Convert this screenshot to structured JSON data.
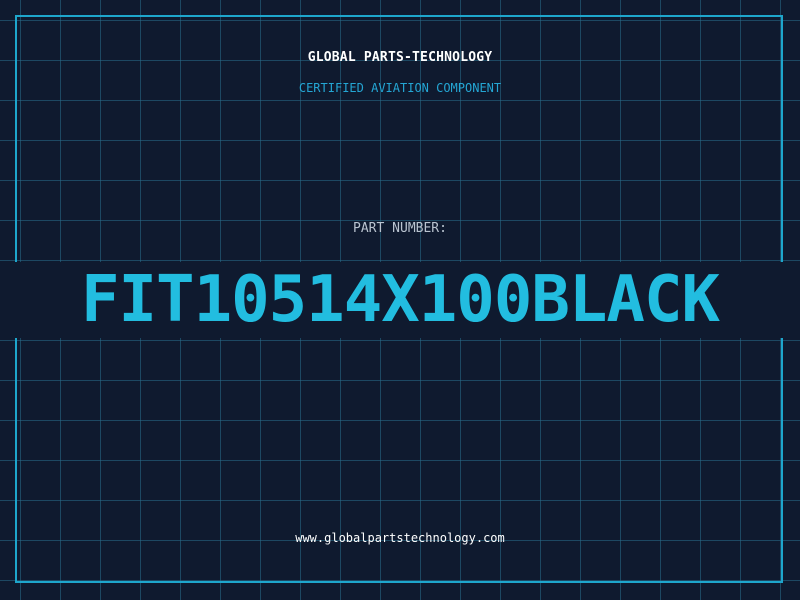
{
  "header": {
    "brand": "GLOBAL PARTS-TECHNOLOGY",
    "tagline": "CERTIFIED AVIATION COMPONENT"
  },
  "part": {
    "label": "PART NUMBER:",
    "number": "FIT10514X100BLACK"
  },
  "footer": {
    "website": "www.globalpartstechnology.com"
  },
  "colors": {
    "background": "#0f1a2f",
    "grid": "#286e8c",
    "frame": "#1ea6cc",
    "accent": "#22bde0",
    "tagline": "#24a6d4",
    "label": "#b9c3cf",
    "text": "#ffffff"
  }
}
